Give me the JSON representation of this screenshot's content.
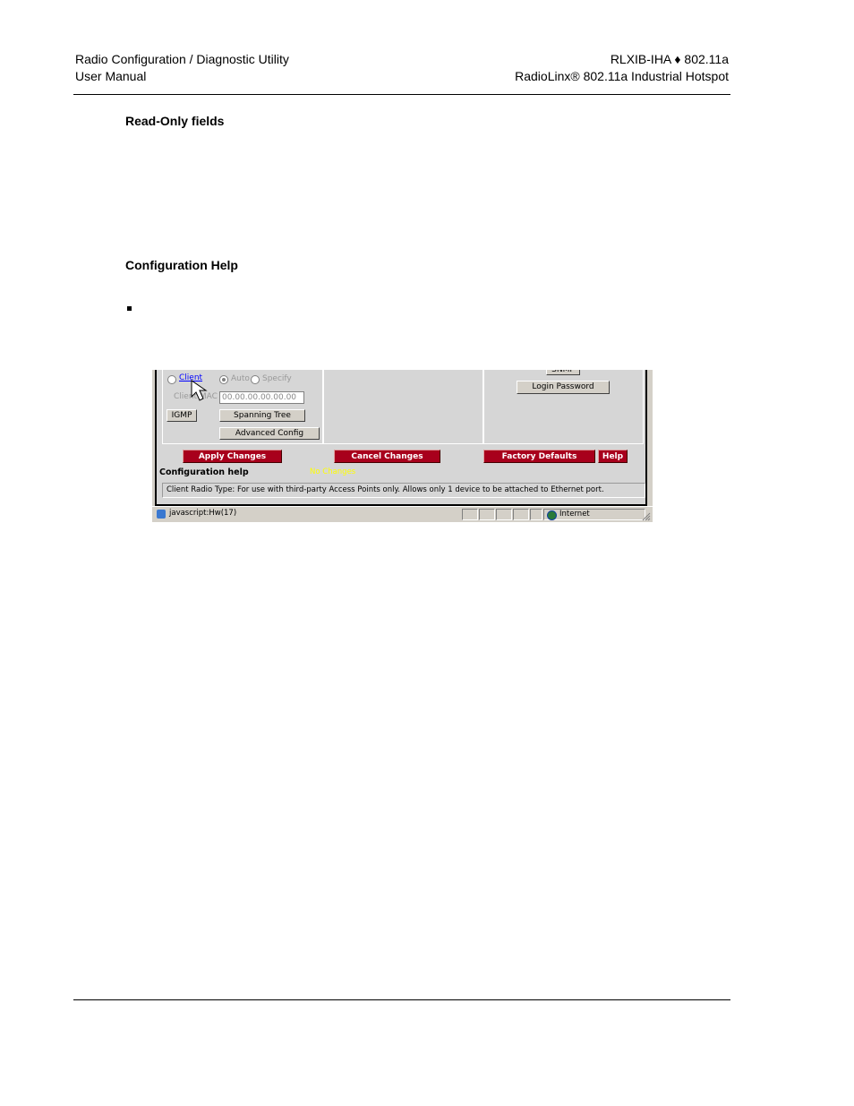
{
  "header": {
    "left_line1": "Radio Configuration / Diagnostic Utility",
    "left_line2": "User Manual",
    "right_line1": "RLXIB-IHA ♦ 802.11a",
    "right_line2": "RadioLinx® 802.11a Industrial Hotspot"
  },
  "sections": {
    "read_only_title": "Read-Only fields",
    "config_help_title": "Configuration Help"
  },
  "screenshot": {
    "radio_client_label": "Client",
    "radio_auto_label": "Auto",
    "radio_specify_label": "Specify",
    "client_mac_label": "Client MAC",
    "client_mac_value": "00.00.00.00.00.00",
    "igmp_button": "IGMP",
    "spanning_tree_button": "Spanning Tree",
    "advanced_config_button": "Advanced Config",
    "snmp_button": "SNMP",
    "login_password_button": "Login Password",
    "apply_changes_button": "Apply Changes",
    "cancel_changes_button": "Cancel Changes",
    "factory_defaults_button": "Factory Defaults",
    "help_button": "Help",
    "config_help_label": "Configuration help",
    "no_changes_status": "No Changes",
    "help_text": "Client Radio Type: For use with third-party Access Points only.  Allows only 1 device to be attached to Ethernet port.",
    "status_url": "javascript:Hw(17)",
    "status_zone": "Internet",
    "colors": {
      "button_red": "#a8001c",
      "no_changes_yellow": "#ffff00",
      "link_blue": "#0000ff"
    }
  }
}
